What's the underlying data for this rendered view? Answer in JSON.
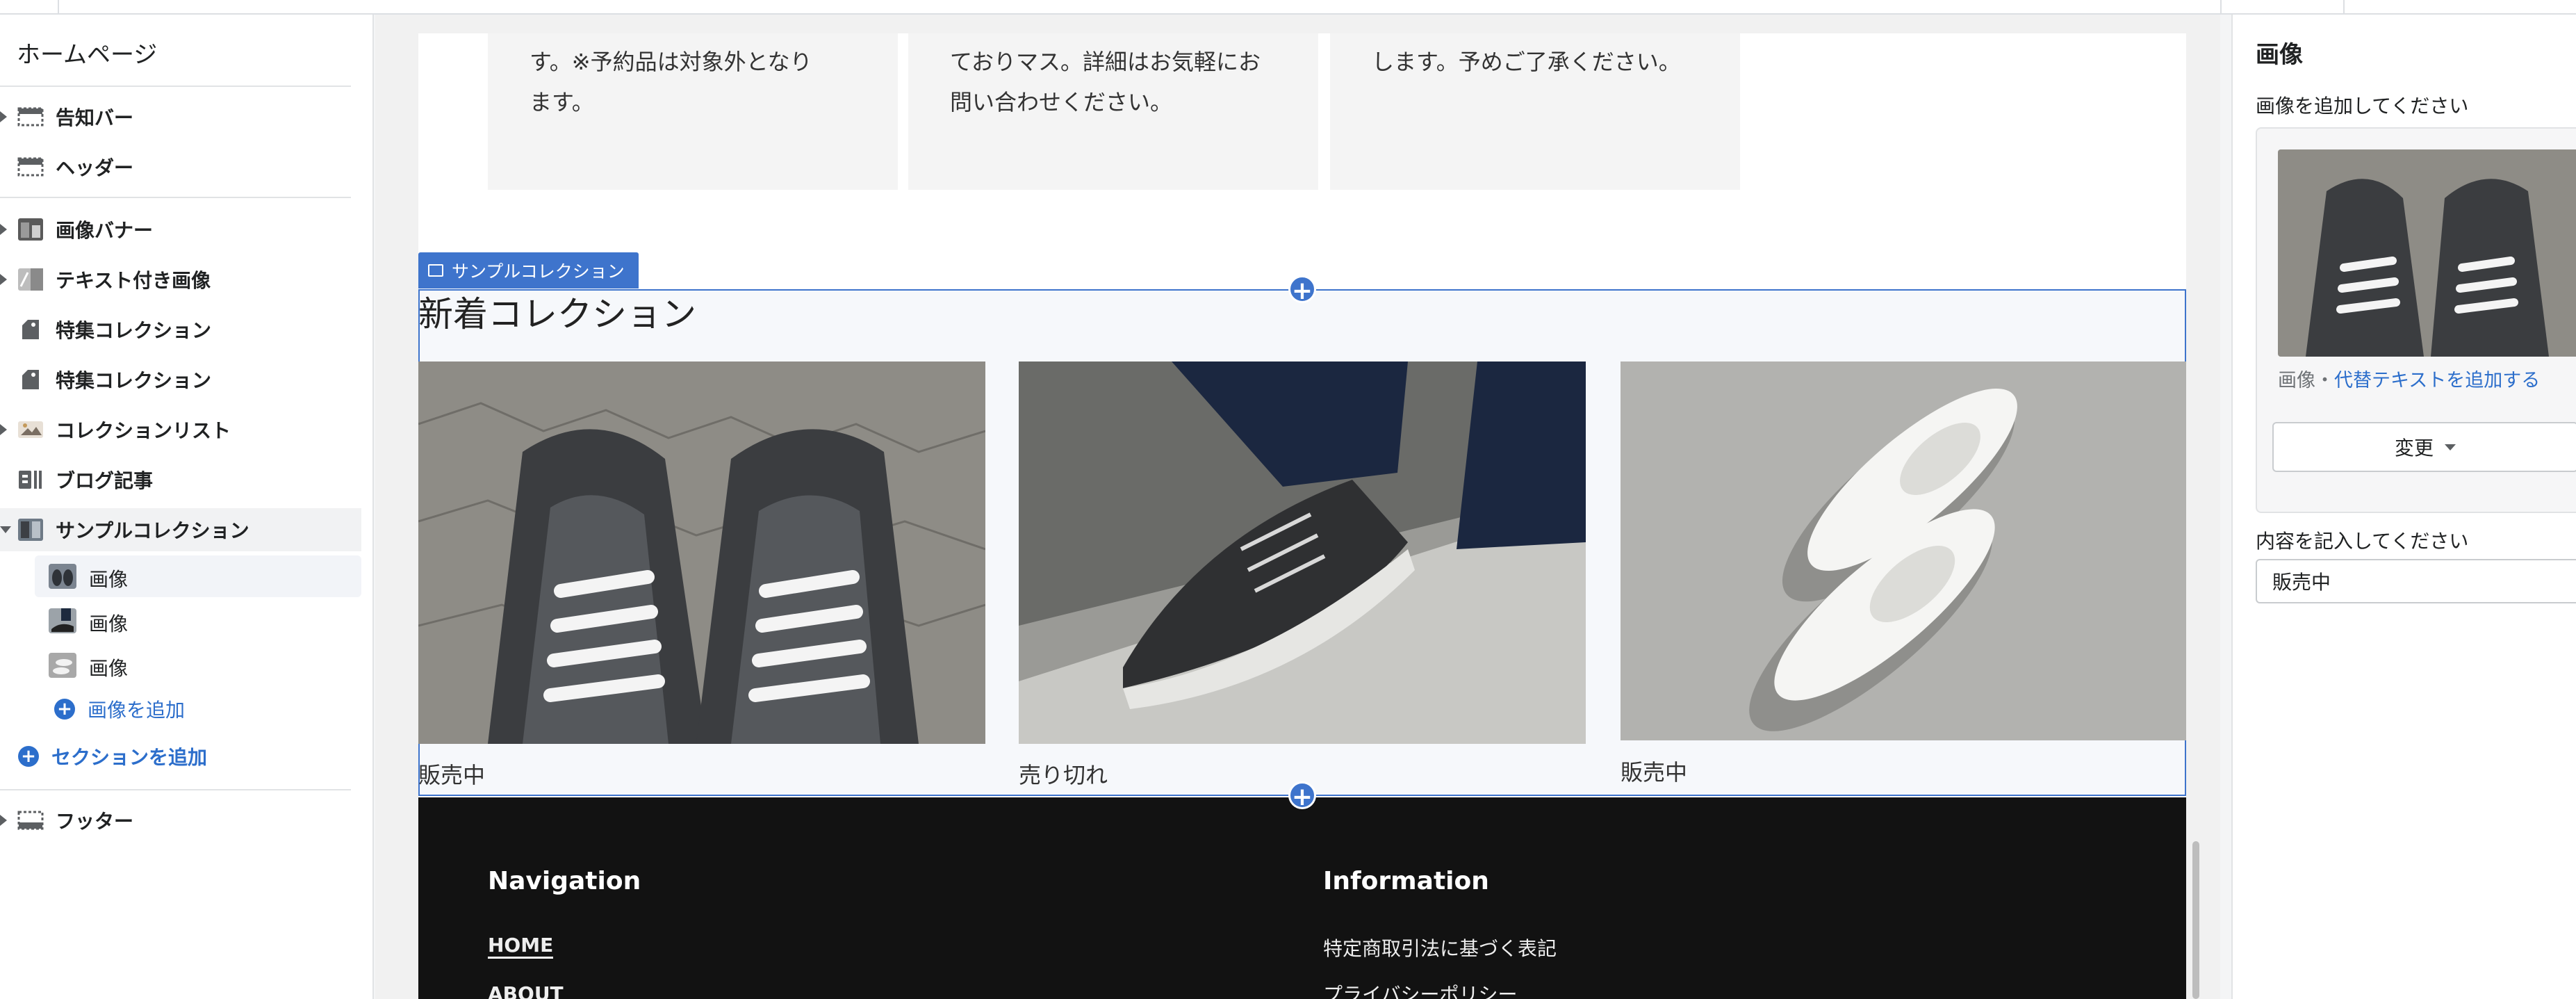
{
  "sidebar": {
    "title": "ホームページ",
    "items": [
      {
        "label": "告知バー",
        "icon": "announcement-bar-icon"
      },
      {
        "label": "ヘッダー",
        "icon": "header-icon"
      },
      {
        "label": "画像バナー",
        "icon": "image-banner-icon"
      },
      {
        "label": "テキスト付き画像",
        "icon": "image-with-text-icon"
      },
      {
        "label": "特集コレクション",
        "icon": "featured-collection-icon"
      },
      {
        "label": "特集コレクション",
        "icon": "featured-collection-icon"
      },
      {
        "label": "コレクションリスト",
        "icon": "collection-list-icon"
      },
      {
        "label": "ブログ記事",
        "icon": "blog-posts-icon"
      },
      {
        "label": "サンプルコレクション",
        "icon": "collage-icon"
      }
    ],
    "sub_items": [
      {
        "label": "画像"
      },
      {
        "label": "画像"
      },
      {
        "label": "画像"
      }
    ],
    "add_image": "画像を追加",
    "add_section": "セクションを追加",
    "footer_item": "フッター"
  },
  "preview": {
    "cards": [
      "す。※予約品は対象外となり\nます。",
      "ておりマス。詳細はお気軽にお\n問い合わせください。",
      "します。予めご了承ください。"
    ],
    "section_label": "サンプルコレクション",
    "section_title": "新着コレクション",
    "captions": [
      "販売中",
      "売り切れ",
      "販売中"
    ],
    "footer": {
      "col1_heading": "Navigation",
      "col1_links": [
        "HOME",
        "ABOUT"
      ],
      "col2_heading": "Information",
      "col2_links": [
        "特定商取引法に基づく表記",
        "プライバシーポリシー"
      ]
    }
  },
  "right_panel": {
    "title": "画像",
    "image_label": "画像を追加してください",
    "alt_prefix": "画像・",
    "alt_link": "代替テキストを追加する",
    "change_button": "変更",
    "content_label": "内容を記入してください",
    "content_value": "販売中"
  },
  "colors": {
    "accent": "#3e74cc",
    "link": "#2c6ecb",
    "footer_bg": "#121212"
  }
}
